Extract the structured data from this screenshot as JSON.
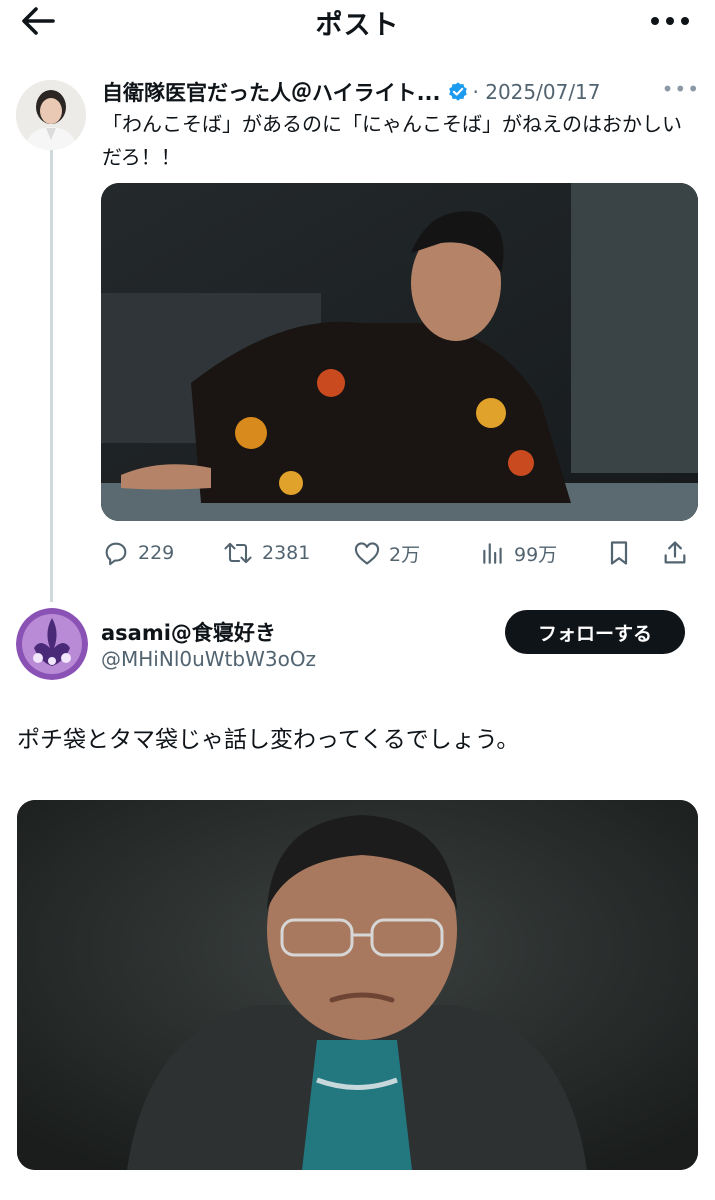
{
  "header": {
    "title": "ポスト",
    "back_icon": "arrow-left-icon",
    "more_icon": "more-horizontal-icon"
  },
  "quoted_post": {
    "author_name": "自衛隊医官だった人＠ハイライト...",
    "verified_icon": "verified-badge-icon",
    "date": "· 2025/07/17",
    "more_label": "•••",
    "text": "「わんこそば」があるのに「にゃんこそば」がねえのはおかしいだろ！！",
    "media_icon": "photo-icon",
    "stats": {
      "replies": "229",
      "reposts": "2381",
      "likes": "2万",
      "views": "99万"
    }
  },
  "reply": {
    "author_name": "asami@食寝好き",
    "handle": "@MHiNl0uWtbW3oOz",
    "follow_label": "フォローする",
    "text": "ポチ袋とタマ袋じゃ話し変わってくるでしょう。",
    "media_icon": "photo-icon"
  },
  "colors": {
    "text_primary": "#0f1419",
    "text_secondary": "#536471",
    "verified_blue": "#1d9bf0",
    "follow_button_bg": "#0f1419",
    "thread_line": "#cfd9de"
  }
}
